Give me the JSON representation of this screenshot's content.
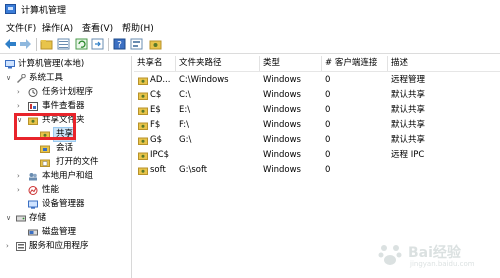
{
  "window": {
    "title": "计算机管理"
  },
  "menu": [
    "文件(F)",
    "操作(A)",
    "查看(V)",
    "帮助(H)"
  ],
  "toolbar_icons": [
    "back-arrow-icon",
    "forward-arrow-icon",
    "folder-icon",
    "view-list-icon",
    "refresh-icon",
    "export-icon",
    "help-icon",
    "properties-icon",
    "new-share-icon"
  ],
  "tree": [
    {
      "label": "计算机管理(本地)",
      "icon": "computer-icon"
    },
    {
      "label": "系统工具",
      "icon": "tools-icon"
    },
    {
      "label": "任务计划程序",
      "icon": "clock-icon"
    },
    {
      "label": "事件查看器",
      "icon": "event-viewer-icon"
    },
    {
      "label": "共享文件夹",
      "icon": "shared-folder-icon"
    },
    {
      "label": "共享",
      "icon": "share-icon"
    },
    {
      "label": "会话",
      "icon": "session-icon"
    },
    {
      "label": "打开的文件",
      "icon": "open-files-icon"
    },
    {
      "label": "本地用户和组",
      "icon": "users-icon"
    },
    {
      "label": "性能",
      "icon": "performance-icon"
    },
    {
      "label": "设备管理器",
      "icon": "device-manager-icon"
    },
    {
      "label": "存储",
      "icon": "storage-icon"
    },
    {
      "label": "磁盘管理",
      "icon": "disk-icon"
    },
    {
      "label": "服务和应用程序",
      "icon": "services-icon"
    }
  ],
  "table": {
    "headers": [
      "共享名",
      "文件夹路径",
      "类型",
      "# 客户端连接",
      "描述"
    ],
    "rows": [
      [
        "AD...",
        "C:\\Windows",
        "Windows",
        "0",
        "远程管理"
      ],
      [
        "C$",
        "C:\\",
        "Windows",
        "0",
        "默认共享"
      ],
      [
        "E$",
        "E:\\",
        "Windows",
        "0",
        "默认共享"
      ],
      [
        "F$",
        "F:\\",
        "Windows",
        "0",
        "默认共享"
      ],
      [
        "G$",
        "G:\\",
        "Windows",
        "0",
        "默认共享"
      ],
      [
        "IPC$",
        "",
        "Windows",
        "0",
        "远程 IPC"
      ],
      [
        "soft",
        "G:\\soft",
        "Windows",
        "0",
        ""
      ]
    ]
  },
  "watermark": {
    "text": "Bai经验",
    "sub": "jingyan.baidu.com"
  },
  "colors": {
    "highlight": "#e8242b",
    "selection": "#cce4f7",
    "accent": "#3b7dd8"
  }
}
